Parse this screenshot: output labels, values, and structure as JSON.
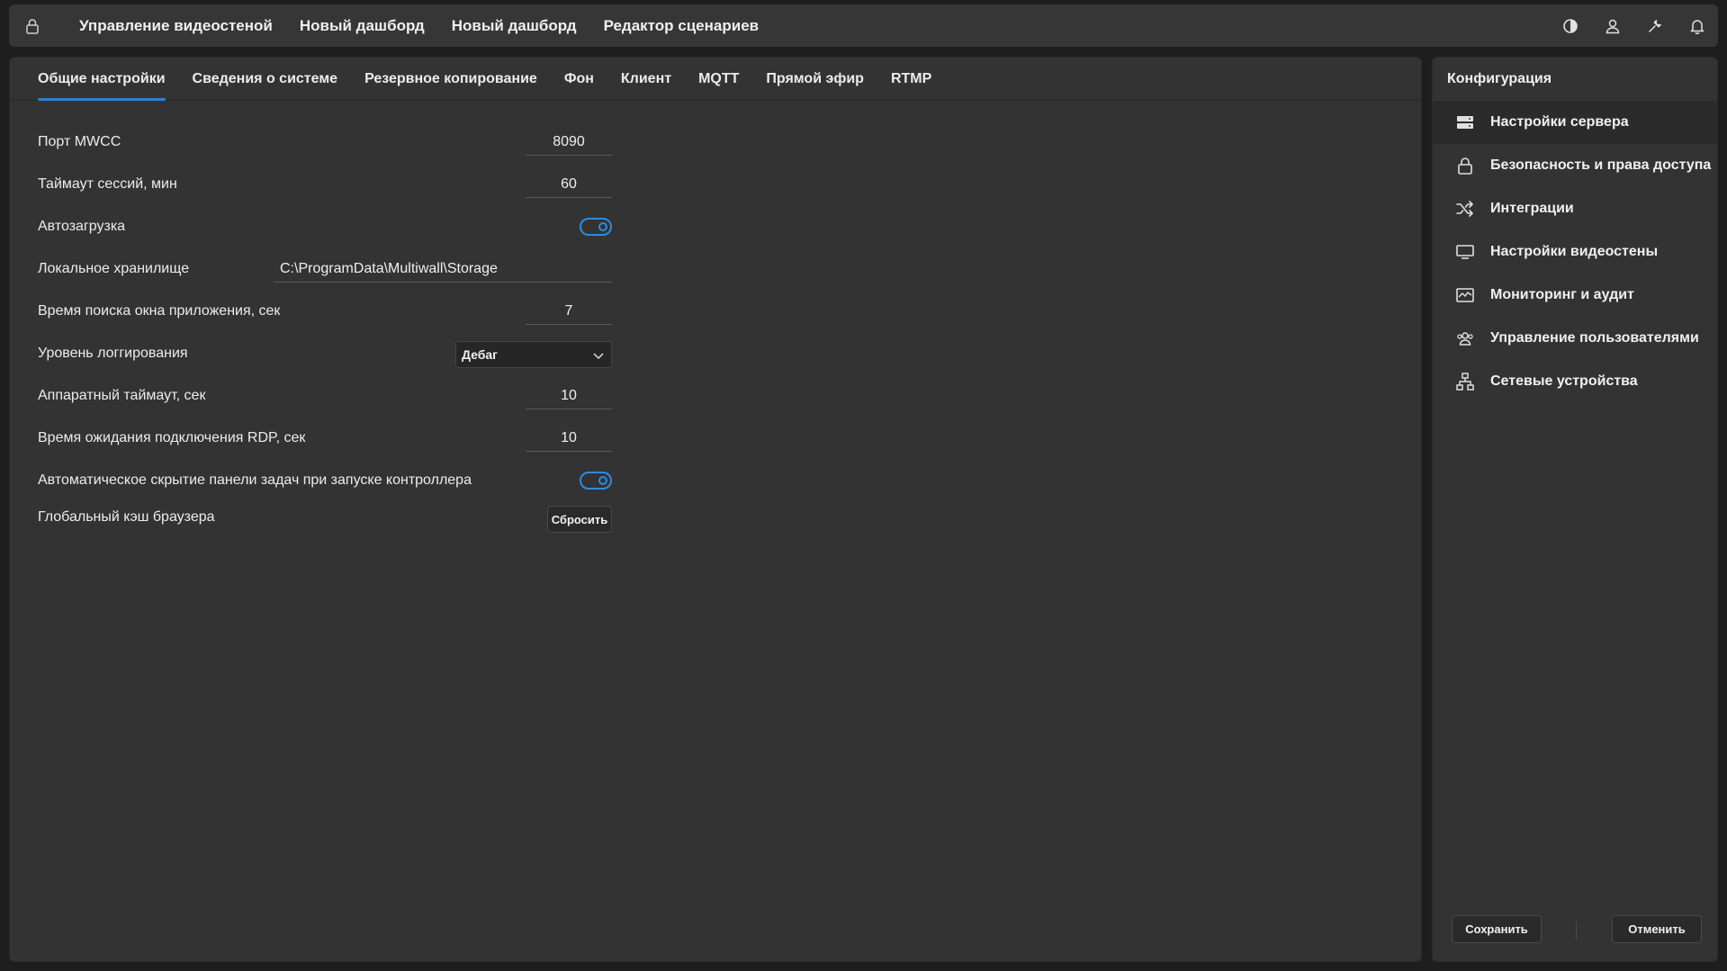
{
  "topbar": {
    "nav": [
      "Управление видеостеной",
      "Новый дашборд",
      "Новый дашборд",
      "Редактор сценариев"
    ]
  },
  "tabs": [
    "Общие настройки",
    "Сведения о системе",
    "Резервное копирование",
    "Фон",
    "Клиент",
    "MQTT",
    "Прямой эфир",
    "RTMP"
  ],
  "settings": {
    "port_label": "Порт MWCC",
    "port_value": "8090",
    "session_timeout_label": "Таймаут сессий, мин",
    "session_timeout_value": "60",
    "autoload_label": "Автозагрузка",
    "autoload_on": true,
    "storage_label": "Локальное хранилище",
    "storage_value": "C:\\ProgramData\\Multiwall\\Storage",
    "window_search_label": "Время поиска окна приложения, сек",
    "window_search_value": "7",
    "log_level_label": "Уровень логгирования",
    "log_level_value": "Дебаг",
    "hw_timeout_label": "Аппаратный таймаут, сек",
    "hw_timeout_value": "10",
    "rdp_timeout_label": "Время ожидания подключения RDP, сек",
    "rdp_timeout_value": "10",
    "autohide_label": "Автоматическое скрытие панели задач при запуске контроллера",
    "autohide_on": true,
    "cache_label": "Глобальный кэш браузера",
    "reset_label": "Сбросить"
  },
  "sidebar": {
    "title": "Конфигурация",
    "items": [
      {
        "label": "Настройки сервера",
        "icon": "server-icon"
      },
      {
        "label": "Безопасность и права доступа",
        "icon": "lock-icon"
      },
      {
        "label": "Интеграции",
        "icon": "shuffle-icon"
      },
      {
        "label": "Настройки видеостены",
        "icon": "monitor-icon"
      },
      {
        "label": "Мониторинг и аудит",
        "icon": "monitoring-icon"
      },
      {
        "label": "Управление пользователями",
        "icon": "users-icon"
      },
      {
        "label": "Сетевые устройства",
        "icon": "network-icon"
      }
    ],
    "save_label": "Сохранить",
    "cancel_label": "Отменить"
  },
  "colors": {
    "accent": "#2f8ae0",
    "panel": "#333333",
    "background": "#1e1e1e"
  }
}
